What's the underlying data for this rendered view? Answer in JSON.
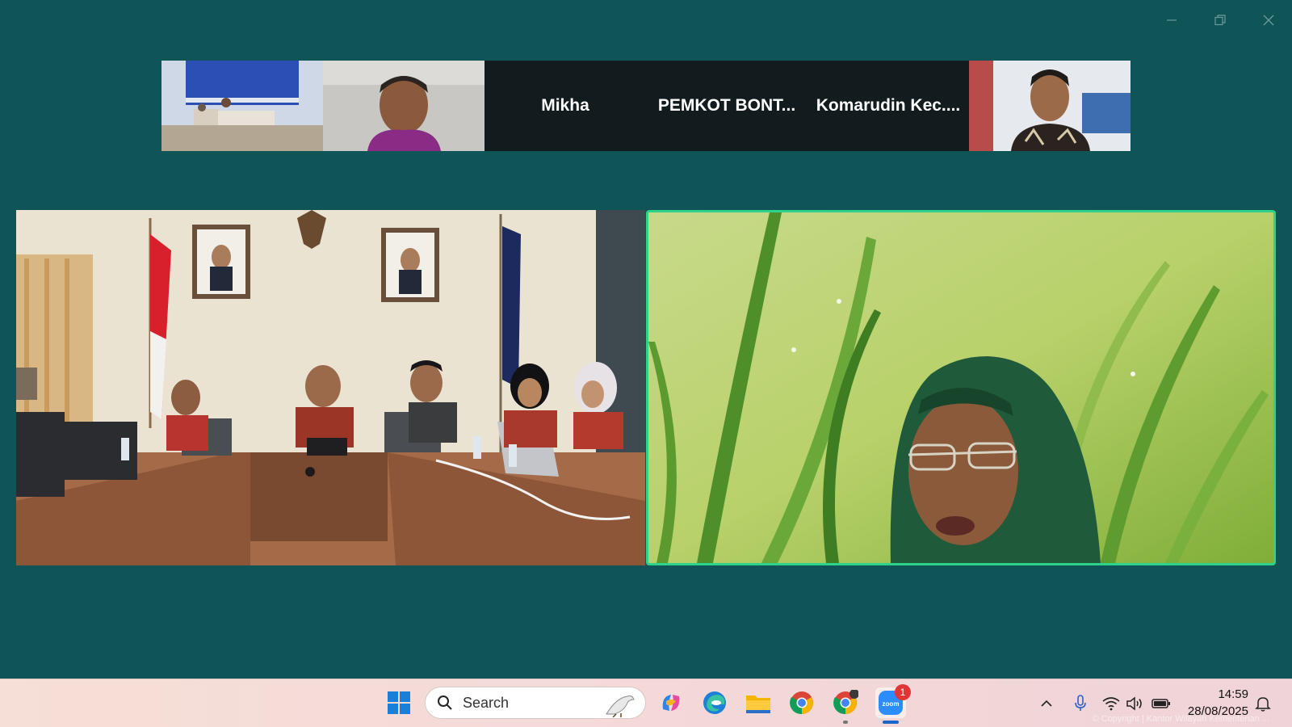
{
  "participants_strip": {
    "name_tiles": [
      "Mikha",
      "PEMKOT  BONT...",
      "Komarudin  Kec...."
    ]
  },
  "taskbar": {
    "search_label": "Search",
    "zoom_badge": "1",
    "time": "14:59",
    "date": "28/08/2025",
    "watermark": "© Copyright | Kantor Wilayah Kementerian ..."
  },
  "colors": {
    "background": "#0f5558",
    "active_speaker_border": "#2fd28a",
    "taskbar": "#f4d9d8"
  },
  "icons": [
    "minimize-icon",
    "restore-icon",
    "close-icon",
    "windows-start-icon",
    "search-icon",
    "copilot-icon",
    "edge-icon",
    "file-explorer-icon",
    "chrome-icon",
    "chrome-profile-icon",
    "zoom-icon",
    "chevron-up-icon",
    "microphone-icon",
    "wifi-icon",
    "volume-icon",
    "battery-icon",
    "notification-icon"
  ]
}
